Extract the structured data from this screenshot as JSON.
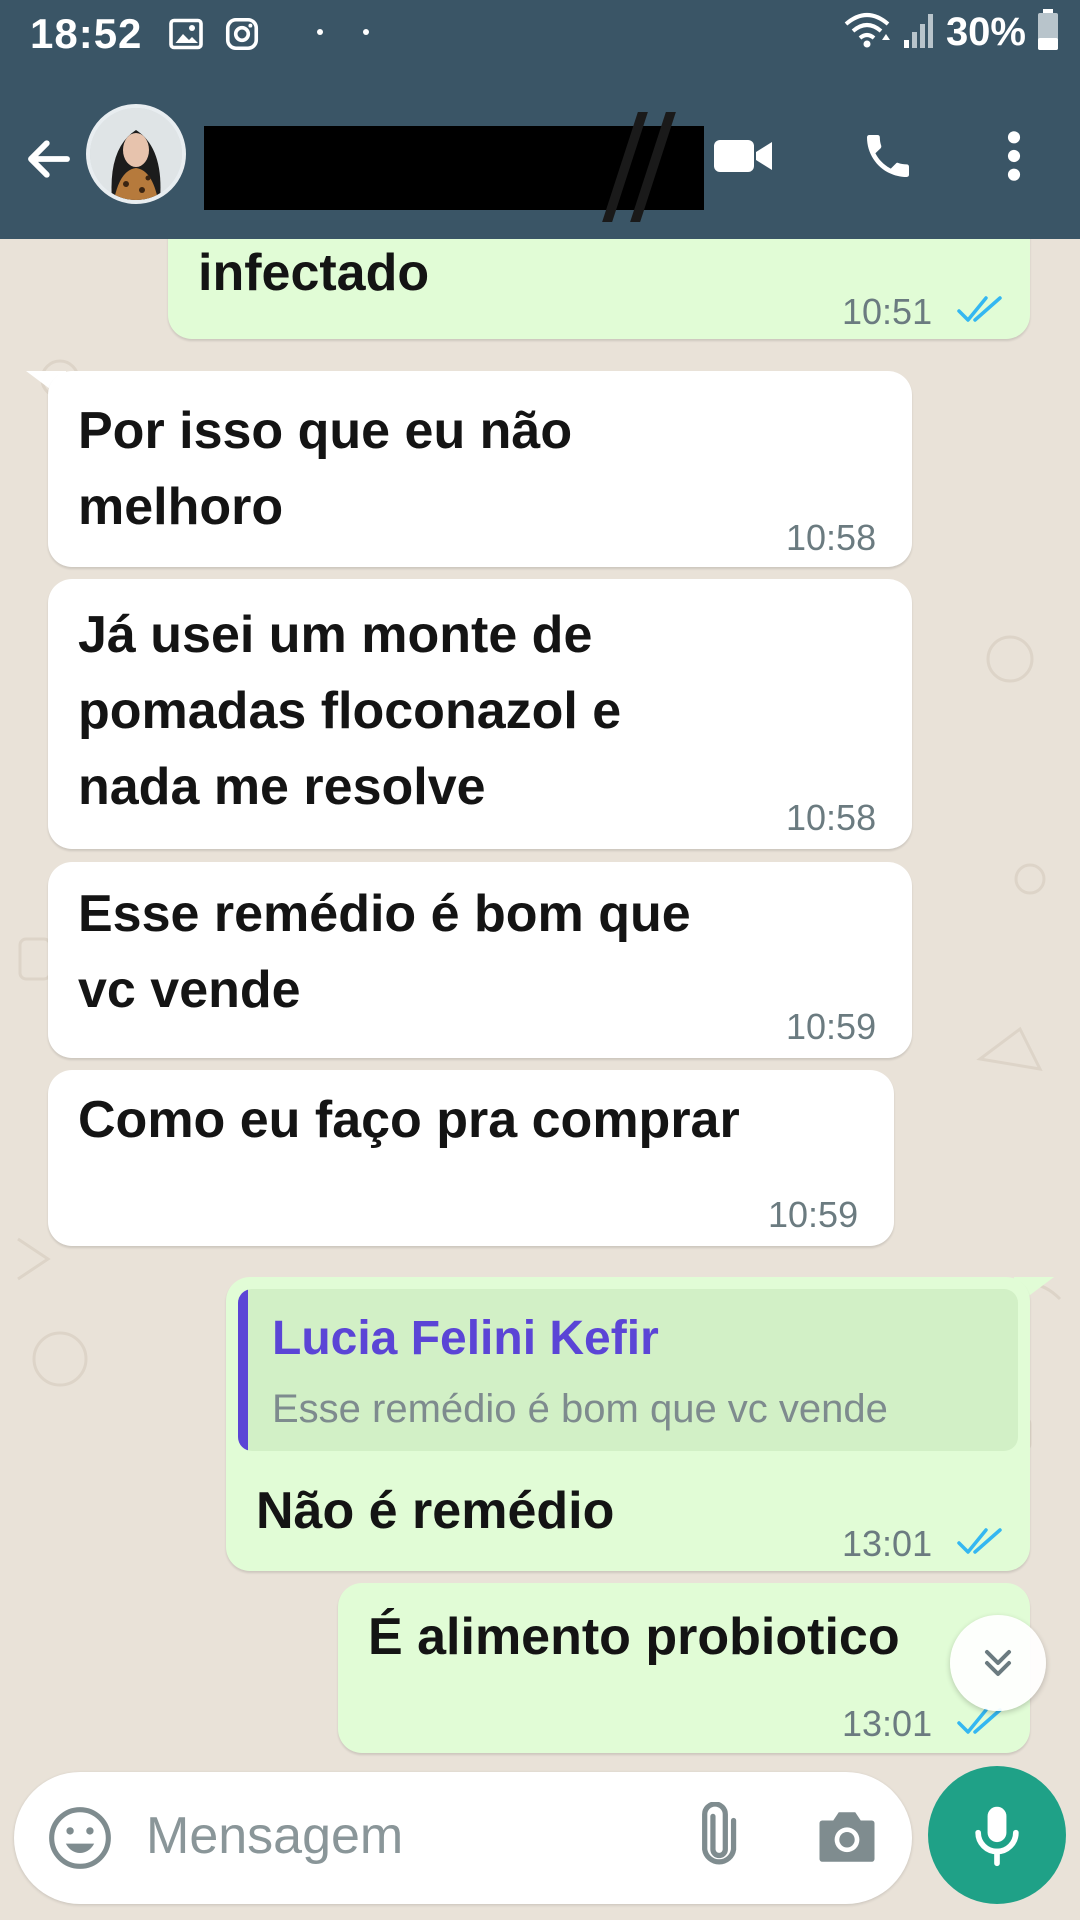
{
  "status_bar": {
    "time": "18:52",
    "battery": "30%",
    "icons": [
      "image-icon",
      "instagram-icon",
      "notification-dots",
      "wifi-icon",
      "signal-icon",
      "battery-icon"
    ]
  },
  "header": {
    "contact_name": "",
    "icons": [
      "back-arrow-icon",
      "video-call-icon",
      "voice-call-icon",
      "more-options-icon"
    ]
  },
  "messages": [
    {
      "direction": "outgoing",
      "text": "infectado",
      "time": "10:51",
      "status": "read"
    },
    {
      "direction": "incoming",
      "text": "Por isso que eu  não\nmelhoro",
      "time": "10:58"
    },
    {
      "direction": "incoming",
      "text": "Já usei um monte de\npomadas floconazol  e\nnada me resolve",
      "time": "10:58"
    },
    {
      "direction": "incoming",
      "text": "Esse remédio  é  bom que\nvc vende",
      "time": "10:59"
    },
    {
      "direction": "incoming",
      "text": "Como eu faço pra comprar",
      "time": "10:59"
    },
    {
      "direction": "outgoing",
      "reply_to": {
        "author": "Lucia Felini Kefir",
        "text": "Esse remédio  é  bom que vc vende"
      },
      "text": "Não é remédio",
      "time": "13:01",
      "status": "read"
    },
    {
      "direction": "outgoing",
      "text": "É alimento probiotico",
      "time": "13:01",
      "status": "read"
    }
  ],
  "composer": {
    "placeholder": "Mensagem",
    "icons": [
      "emoji-icon",
      "attach-icon",
      "camera-icon",
      "mic-icon"
    ]
  },
  "colors": {
    "header": "#3a5566",
    "chat_background": "#e9e2d8",
    "outgoing_bubble": "#e1fcd6",
    "incoming_bubble": "#ffffff",
    "read_ticks": "#34b7f1",
    "reply_accent": "#5b45d6",
    "mic_button": "#1fa187"
  }
}
